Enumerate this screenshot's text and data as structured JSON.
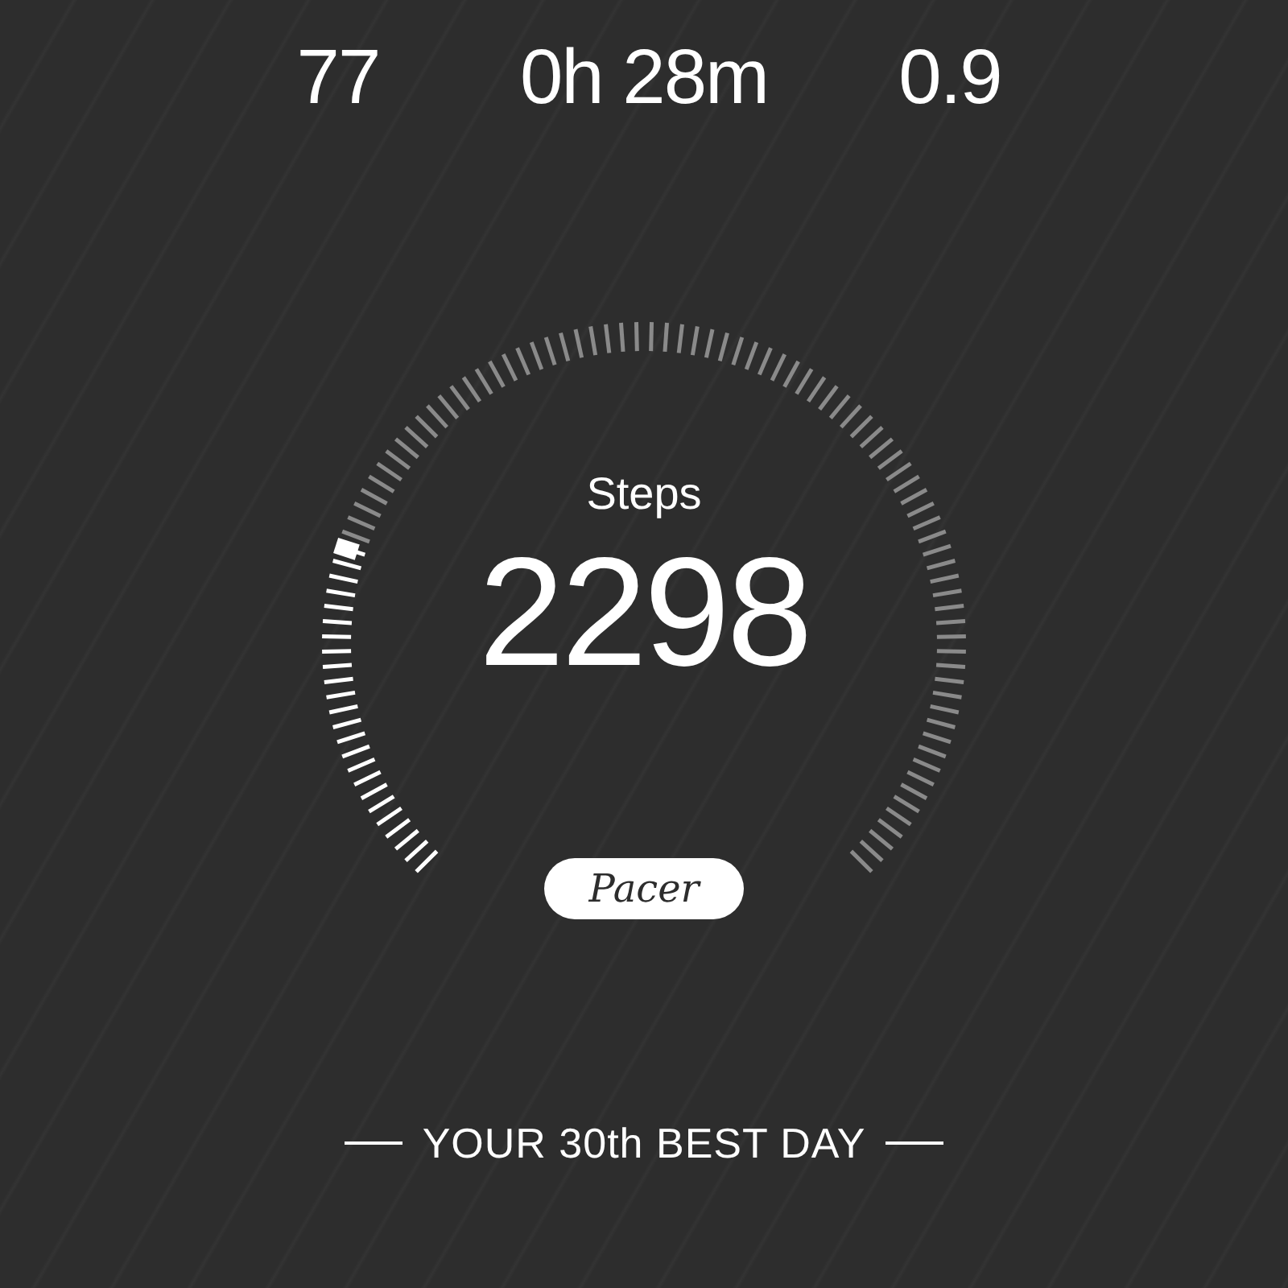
{
  "stats": [
    {
      "value": "77"
    },
    {
      "value": "0h 28m"
    },
    {
      "value": "0.9"
    }
  ],
  "steps": {
    "label": "Steps",
    "value": "2298"
  },
  "logo": {
    "text": "Pacer"
  },
  "rank": {
    "text": "YOUR 30th BEST DAY"
  }
}
